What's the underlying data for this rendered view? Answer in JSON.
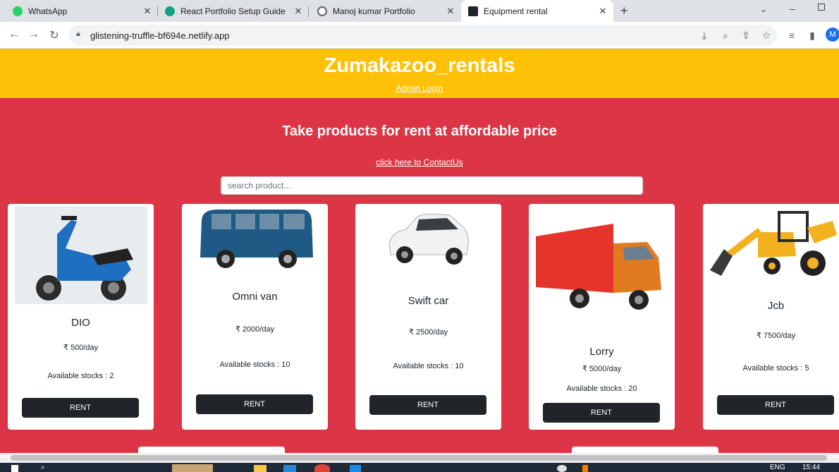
{
  "browser": {
    "tabs": [
      {
        "title": "WhatsApp",
        "icon": "whatsapp-icon",
        "color": "#25d366"
      },
      {
        "title": "React Portfolio Setup Guide",
        "icon": "chatgpt-icon",
        "color": "#10a37f"
      },
      {
        "title": "Manoj kumar Portfolio",
        "icon": "globe-icon",
        "color": "#5f6368"
      },
      {
        "title": "Equipment rental",
        "icon": "react-icon",
        "color": "#61dafb"
      }
    ],
    "url": "glistening-truffle-bf694e.netlify.app",
    "profile_initial": "M"
  },
  "site": {
    "title": "Zumakazoo_rentals",
    "admin_link": "Admin Login",
    "tagline": "Take products for rent at affordable price",
    "contact_link": "click here to ContactUs",
    "search_placeholder": "search product...",
    "colors": {
      "header": "#ffc107",
      "main": "#dc3545",
      "button": "#212529"
    }
  },
  "products": [
    {
      "name": "DIO",
      "price": "₹ 500/day",
      "stock": "Available stocks : 2",
      "button": "RENT",
      "image": "scooter"
    },
    {
      "name": "Omni van",
      "price": "₹ 2000/day",
      "stock": "Available stocks : 10",
      "button": "RENT",
      "image": "van"
    },
    {
      "name": "Swift car",
      "price": "₹ 2500/day",
      "stock": "Available stocks : 10",
      "button": "RENT",
      "image": "car"
    },
    {
      "name": "Lorry",
      "price": "₹ 5000/day",
      "stock": "Available stocks : 20",
      "button": "RENT",
      "image": "truck"
    },
    {
      "name": "Jcb",
      "price": "₹ 7500/day",
      "stock": "Available stocks : 5",
      "button": "RENT",
      "image": "backhoe"
    }
  ],
  "taskbar": {
    "language": "ENG",
    "time": "15:44"
  }
}
